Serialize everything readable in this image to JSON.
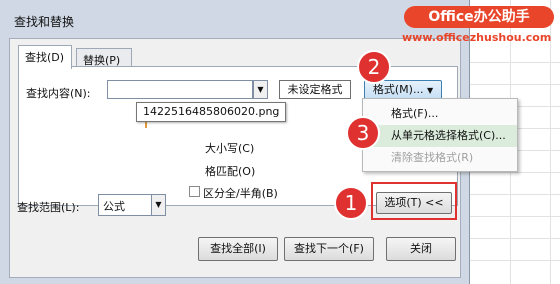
{
  "window": {
    "title": "查找和替换"
  },
  "watermark": {
    "brand": "Office办公助手",
    "url": "www.officezhushou.com"
  },
  "tabs": [
    {
      "label": "查找(D)",
      "active": true
    },
    {
      "label": "替换(P)",
      "active": false
    }
  ],
  "find": {
    "label": "查找内容(N):",
    "value": "",
    "format_status": "未设定格式",
    "format_button": "格式(M)...",
    "tooltip": "1422516485806020.png"
  },
  "options": {
    "match_case": "大小写(C)",
    "match_cell": "格匹配(O)",
    "width": "区分全/半角(B)"
  },
  "scope": {
    "label": "查找范围(L):",
    "value": "公式"
  },
  "format_menu": {
    "items": [
      {
        "label": "格式(F)...",
        "state": "normal"
      },
      {
        "label": "从单元格选择格式(C)...",
        "state": "highlighted"
      },
      {
        "label": "清除查找格式(R)",
        "state": "disabled"
      }
    ]
  },
  "buttons": {
    "options": "选项(T) <<",
    "find_all": "查找全部(I)",
    "find_next": "查找下一个(F)",
    "close": "关闭"
  },
  "callouts": [
    "1",
    "2",
    "3"
  ],
  "colors": {
    "callout": "#e03131",
    "dialog_frame": "#cfd8e4",
    "menu_highlight": "#dcecdc",
    "brand": "#e8452a"
  }
}
